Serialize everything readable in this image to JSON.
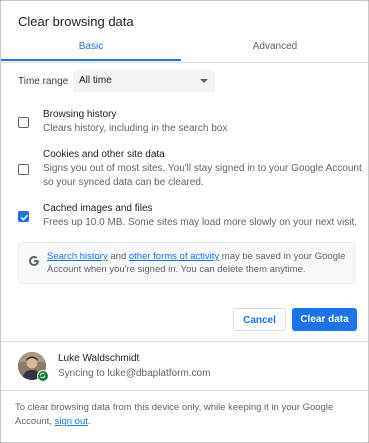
{
  "dialog": {
    "title": "Clear browsing data"
  },
  "tabs": [
    {
      "label": "Basic",
      "selected": true
    },
    {
      "label": "Advanced",
      "selected": false
    }
  ],
  "time_range": {
    "label": "Time range",
    "value": "All time"
  },
  "options": [
    {
      "title": "Browsing history",
      "description": "Clears history, including in the search box",
      "checked": false
    },
    {
      "title": "Cookies and other site data",
      "description": "Signs you out of most sites. You'll stay signed in to your Google Account so your synced data can be cleared.",
      "checked": false
    },
    {
      "title": "Cached images and files",
      "description": "Frees up 10.0 MB. Some sites may load more slowly on your next visit.",
      "checked": true
    }
  ],
  "info": {
    "link1": "Search history",
    "mid": " and ",
    "link2": "other forms of activity",
    "rest": " may be saved in your Google Account when you're signed in. You can delete them anytime."
  },
  "buttons": {
    "cancel": "Cancel",
    "clear": "Clear data"
  },
  "account": {
    "name": "Luke Waldschmidt",
    "sync_text": "Syncing to luke@dbaplatform.com"
  },
  "footer": {
    "text": "To clear browsing data from this device only, while keeping it in your Google Account, ",
    "link": "sign out",
    "end": "."
  },
  "colors": {
    "accent": "#1a73e8",
    "sync_green": "#188038"
  }
}
